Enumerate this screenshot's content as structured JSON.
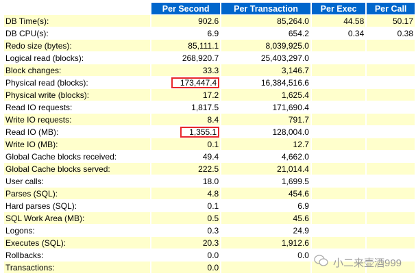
{
  "headers": [
    "",
    "Per Second",
    "Per Transaction",
    "Per Exec",
    "Per Call"
  ],
  "rows": [
    [
      "DB Time(s):",
      "902.6",
      "85,264.0",
      "44.58",
      "50.17"
    ],
    [
      "DB CPU(s):",
      "6.9",
      "654.2",
      "0.34",
      "0.38"
    ],
    [
      "Redo size (bytes):",
      "85,111.1",
      "8,039,925.0",
      "",
      ""
    ],
    [
      "Logical read (blocks):",
      "268,920.7",
      "25,403,297.0",
      "",
      ""
    ],
    [
      "Block changes:",
      "33.3",
      "3,146.7",
      "",
      ""
    ],
    [
      "Physical read (blocks):",
      "173,447.4",
      "16,384,516.6",
      "",
      ""
    ],
    [
      "Physical write (blocks):",
      "17.2",
      "1,625.4",
      "",
      ""
    ],
    [
      "Read IO requests:",
      "1,817.5",
      "171,690.4",
      "",
      ""
    ],
    [
      "Write IO requests:",
      "8.4",
      "791.7",
      "",
      ""
    ],
    [
      "Read IO (MB):",
      "1,355.1",
      "128,004.0",
      "",
      ""
    ],
    [
      "Write IO (MB):",
      "0.1",
      "12.7",
      "",
      ""
    ],
    [
      "Global Cache blocks received:",
      "49.4",
      "4,662.0",
      "",
      ""
    ],
    [
      "Global Cache blocks served:",
      "222.5",
      "21,014.4",
      "",
      ""
    ],
    [
      "User calls:",
      "18.0",
      "1,699.5",
      "",
      ""
    ],
    [
      "Parses (SQL):",
      "4.8",
      "454.6",
      "",
      ""
    ],
    [
      "Hard parses (SQL):",
      "0.1",
      "6.9",
      "",
      ""
    ],
    [
      "SQL Work Area (MB):",
      "0.5",
      "45.6",
      "",
      ""
    ],
    [
      "Logons:",
      "0.3",
      "24.9",
      "",
      ""
    ],
    [
      "Executes (SQL):",
      "20.3",
      "1,912.6",
      "",
      ""
    ],
    [
      "Rollbacks:",
      "0.0",
      "0.0",
      "",
      ""
    ],
    [
      "Transactions:",
      "0.0",
      "",
      "",
      ""
    ]
  ],
  "highlighted_cells": [
    "Physical read (blocks): Per Second",
    "Read IO (MB): Per Second"
  ],
  "watermark": "小二来壶酒999",
  "colors": {
    "header": "#0066cc",
    "stripe": "#ffffcc",
    "highlight": "#e8262b"
  }
}
